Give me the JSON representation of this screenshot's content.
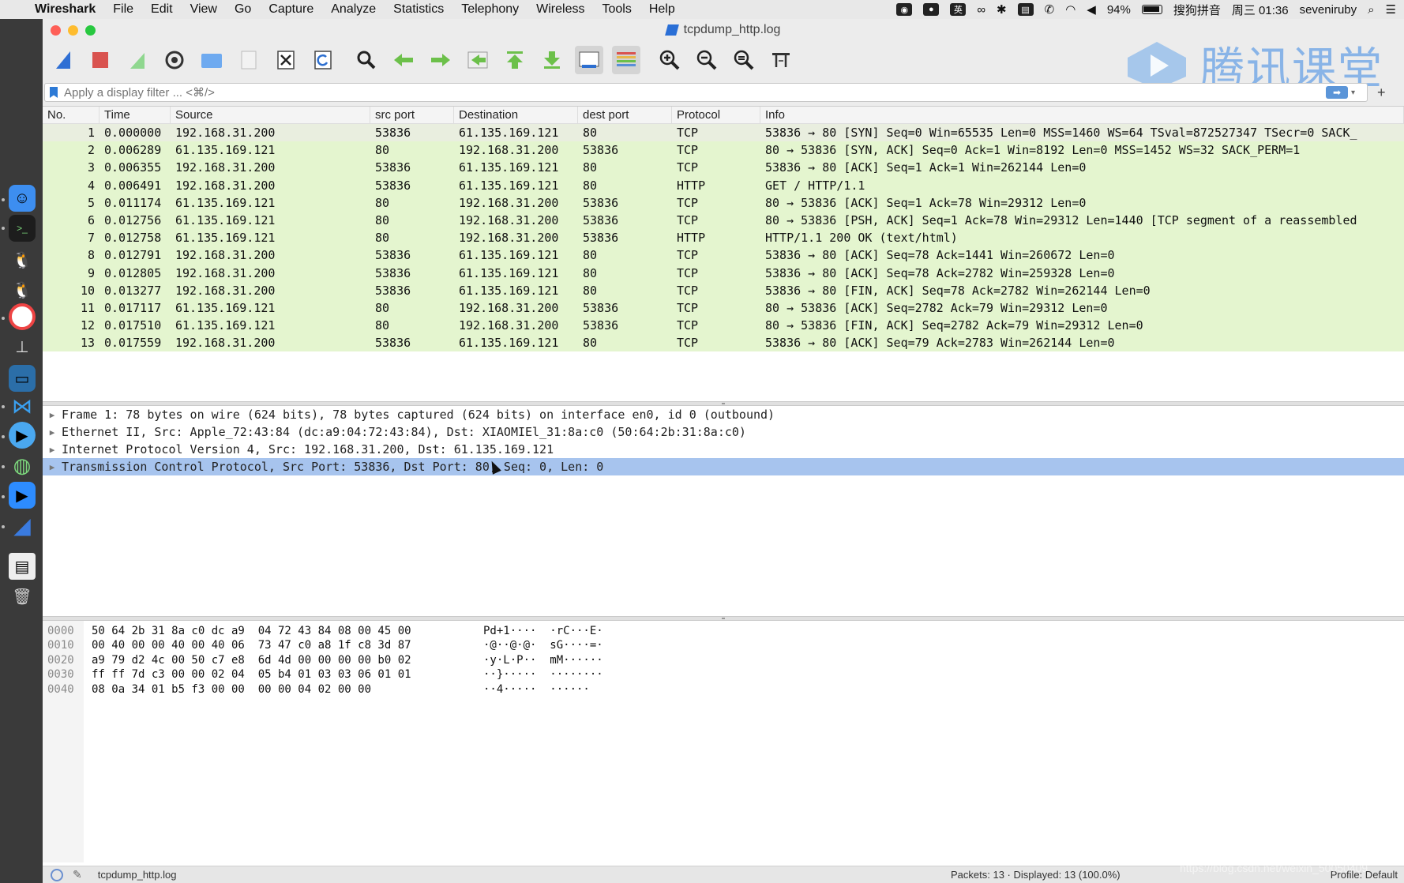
{
  "menubar": {
    "app_name": "Wireshark",
    "items": [
      "File",
      "Edit",
      "View",
      "Go",
      "Capture",
      "Analyze",
      "Statistics",
      "Telephony",
      "Wireless",
      "Tools",
      "Help"
    ],
    "battery": "94%",
    "input_method": "搜狗拼音",
    "clock": "周三 01:36",
    "user": "seveniruby"
  },
  "window": {
    "title": "tcpdump_http.log"
  },
  "watermark": {
    "text": "腾讯课堂"
  },
  "filter": {
    "placeholder": "Apply a display filter ... <⌘/>"
  },
  "packet_list": {
    "columns": [
      "No.",
      "Time",
      "Source",
      "src port",
      "Destination",
      "dest port",
      "Protocol",
      "Info"
    ],
    "rows": [
      {
        "no": "1",
        "time": "0.000000",
        "src": "192.168.31.200",
        "sport": "53836",
        "dst": "61.135.169.121",
        "dport": "80",
        "proto": "TCP",
        "info": "53836 → 80 [SYN] Seq=0 Win=65535 Len=0 MSS=1460 WS=64 TSval=872527347 TSecr=0 SACK_"
      },
      {
        "no": "2",
        "time": "0.006289",
        "src": "61.135.169.121",
        "sport": "80",
        "dst": "192.168.31.200",
        "dport": "53836",
        "proto": "TCP",
        "info": "80 → 53836 [SYN, ACK] Seq=0 Ack=1 Win=8192 Len=0 MSS=1452 WS=32 SACK_PERM=1"
      },
      {
        "no": "3",
        "time": "0.006355",
        "src": "192.168.31.200",
        "sport": "53836",
        "dst": "61.135.169.121",
        "dport": "80",
        "proto": "TCP",
        "info": "53836 → 80 [ACK] Seq=1 Ack=1 Win=262144 Len=0"
      },
      {
        "no": "4",
        "time": "0.006491",
        "src": "192.168.31.200",
        "sport": "53836",
        "dst": "61.135.169.121",
        "dport": "80",
        "proto": "HTTP",
        "info": "GET / HTTP/1.1"
      },
      {
        "no": "5",
        "time": "0.011174",
        "src": "61.135.169.121",
        "sport": "80",
        "dst": "192.168.31.200",
        "dport": "53836",
        "proto": "TCP",
        "info": "80 → 53836 [ACK] Seq=1 Ack=78 Win=29312 Len=0"
      },
      {
        "no": "6",
        "time": "0.012756",
        "src": "61.135.169.121",
        "sport": "80",
        "dst": "192.168.31.200",
        "dport": "53836",
        "proto": "TCP",
        "info": "80 → 53836 [PSH, ACK] Seq=1 Ack=78 Win=29312 Len=1440 [TCP segment of a reassembled"
      },
      {
        "no": "7",
        "time": "0.012758",
        "src": "61.135.169.121",
        "sport": "80",
        "dst": "192.168.31.200",
        "dport": "53836",
        "proto": "HTTP",
        "info": "HTTP/1.1 200 OK  (text/html)"
      },
      {
        "no": "8",
        "time": "0.012791",
        "src": "192.168.31.200",
        "sport": "53836",
        "dst": "61.135.169.121",
        "dport": "80",
        "proto": "TCP",
        "info": "53836 → 80 [ACK] Seq=78 Ack=1441 Win=260672 Len=0"
      },
      {
        "no": "9",
        "time": "0.012805",
        "src": "192.168.31.200",
        "sport": "53836",
        "dst": "61.135.169.121",
        "dport": "80",
        "proto": "TCP",
        "info": "53836 → 80 [ACK] Seq=78 Ack=2782 Win=259328 Len=0"
      },
      {
        "no": "10",
        "time": "0.013277",
        "src": "192.168.31.200",
        "sport": "53836",
        "dst": "61.135.169.121",
        "dport": "80",
        "proto": "TCP",
        "info": "53836 → 80 [FIN, ACK] Seq=78 Ack=2782 Win=262144 Len=0"
      },
      {
        "no": "11",
        "time": "0.017117",
        "src": "61.135.169.121",
        "sport": "80",
        "dst": "192.168.31.200",
        "dport": "53836",
        "proto": "TCP",
        "info": "80 → 53836 [ACK] Seq=2782 Ack=79 Win=29312 Len=0"
      },
      {
        "no": "12",
        "time": "0.017510",
        "src": "61.135.169.121",
        "sport": "80",
        "dst": "192.168.31.200",
        "dport": "53836",
        "proto": "TCP",
        "info": "80 → 53836 [FIN, ACK] Seq=2782 Ack=79 Win=29312 Len=0"
      },
      {
        "no": "13",
        "time": "0.017559",
        "src": "192.168.31.200",
        "sport": "53836",
        "dst": "61.135.169.121",
        "dport": "80",
        "proto": "TCP",
        "info": "53836 → 80 [ACK] Seq=79 Ack=2783 Win=262144 Len=0"
      }
    ]
  },
  "details": {
    "rows": [
      "Frame 1: 78 bytes on wire (624 bits), 78 bytes captured (624 bits) on interface en0, id 0 (outbound)",
      "Ethernet II, Src: Apple_72:43:84 (dc:a9:04:72:43:84), Dst: XIAOMIEl_31:8a:c0 (50:64:2b:31:8a:c0)",
      "Internet Protocol Version 4, Src: 192.168.31.200, Dst: 61.135.169.121",
      "Transmission Control Protocol, Src Port: 53836, Dst Port: 80, Seq: 0, Len: 0"
    ],
    "selected_index": 3
  },
  "bytes": {
    "offsets": [
      "0000",
      "0010",
      "0020",
      "0030",
      "0040"
    ],
    "hex": [
      "50 64 2b 31 8a c0 dc a9  04 72 43 84 08 00 45 00",
      "00 40 00 00 40 00 40 06  73 47 c0 a8 1f c8 3d 87",
      "a9 79 d2 4c 00 50 c7 e8  6d 4d 00 00 00 00 b0 02",
      "ff ff 7d c3 00 00 02 04  05 b4 01 03 03 06 01 01",
      "08 0a 34 01 b5 f3 00 00  00 00 04 02 00 00"
    ],
    "ascii": [
      "Pd+1····  ·rC···E·",
      "·@··@·@·  sG····=·",
      "·y·L·P··  mM······",
      "··}·····  ········",
      "··4·····  ······"
    ]
  },
  "statusbar": {
    "file": "tcpdump_http.log",
    "packets": "Packets: 13 · Displayed: 13 (100.0%)",
    "profile": "Profile: Default"
  },
  "overlay": {
    "csdn": "https://blog.csdn.net/weixin_50050409"
  },
  "colors": {
    "tcp_row": "#e4f5cf",
    "selected_detail": "#a7c4ee"
  }
}
